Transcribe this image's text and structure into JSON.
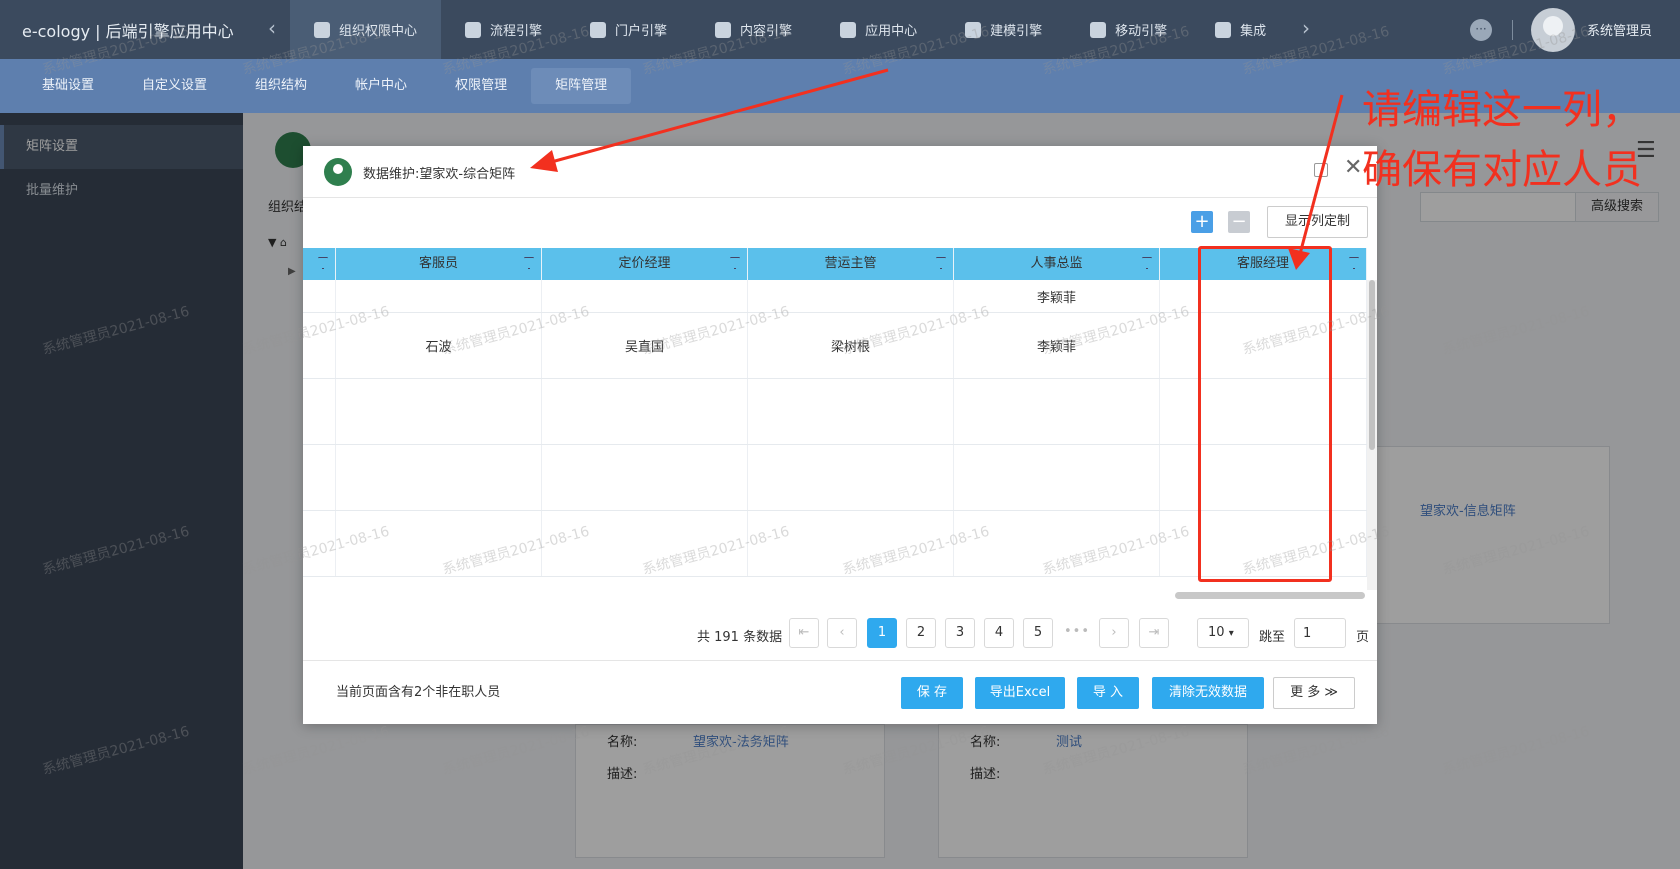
{
  "topbar": {
    "brand": "e-cology | 后端引擎应用中心",
    "nav": [
      {
        "label": "组织权限中心",
        "active": true,
        "icon": "shield-icon"
      },
      {
        "label": "流程引擎",
        "active": false,
        "icon": "flow-icon"
      },
      {
        "label": "门户引擎",
        "active": false,
        "icon": "portal-icon"
      },
      {
        "label": "内容引擎",
        "active": false,
        "icon": "document-icon"
      },
      {
        "label": "应用中心",
        "active": false,
        "icon": "apps-icon"
      },
      {
        "label": "建模引擎",
        "active": false,
        "icon": "cube-icon"
      },
      {
        "label": "移动引擎",
        "active": false,
        "icon": "mobile-icon"
      },
      {
        "label": "集成",
        "active": false,
        "icon": "integration-icon"
      }
    ],
    "username": "系统管理员"
  },
  "subnav": {
    "items": [
      {
        "label": "基础设置",
        "active": false
      },
      {
        "label": "自定义设置",
        "active": false
      },
      {
        "label": "组织结构",
        "active": false
      },
      {
        "label": "帐户中心",
        "active": false
      },
      {
        "label": "权限管理",
        "active": false
      },
      {
        "label": "矩阵管理",
        "active": true
      }
    ]
  },
  "sidebar": {
    "items": [
      {
        "label": "矩阵设置",
        "active": true
      },
      {
        "label": "批量维护",
        "active": false
      }
    ]
  },
  "background": {
    "tree_label": "组织结",
    "advanced_search": "高级搜索",
    "card_info_link": "望家欢-信息矩阵",
    "card_left_name_label": "名称:",
    "card_left_name_value": "望家欢-法务矩阵",
    "card_left_desc_label": "描述:",
    "card_right_name_label": "名称:",
    "card_right_name_value": "测试",
    "card_right_desc_label": "描述:"
  },
  "watermark": "系统管理员2021-08-16",
  "dialog": {
    "title": "数据维护:望家欢-综合矩阵",
    "column_setting_label": "显示列定制",
    "columns": [
      "",
      "客服员",
      "定价经理",
      "营运主管",
      "人事总监",
      "客服经理"
    ],
    "rows": [
      [
        "",
        "",
        "",
        "",
        "李颖菲",
        ""
      ],
      [
        "",
        "石波",
        "吴直国",
        "梁树根",
        "李颖菲",
        ""
      ],
      [
        "",
        "",
        "",
        "",
        "",
        ""
      ],
      [
        "",
        "",
        "",
        "",
        "",
        ""
      ],
      [
        "",
        "",
        "",
        "",
        "",
        ""
      ]
    ],
    "pager": {
      "total_text": "共 191 条数据",
      "pages": [
        "1",
        "2",
        "3",
        "4",
        "5"
      ],
      "current_page": "1",
      "page_size": "10",
      "jump_label": "跳至",
      "jump_value": "1",
      "page_label": "页"
    },
    "footer": {
      "note": "当前页面含有2个非在职人员",
      "save": "保 存",
      "export": "导出Excel",
      "import": "导 入",
      "clear": "清除无效数据",
      "more": "更 多 ≫"
    }
  },
  "annotation": {
    "text": "请编辑这一列，确保有对应人员",
    "color": "#f2301f"
  }
}
